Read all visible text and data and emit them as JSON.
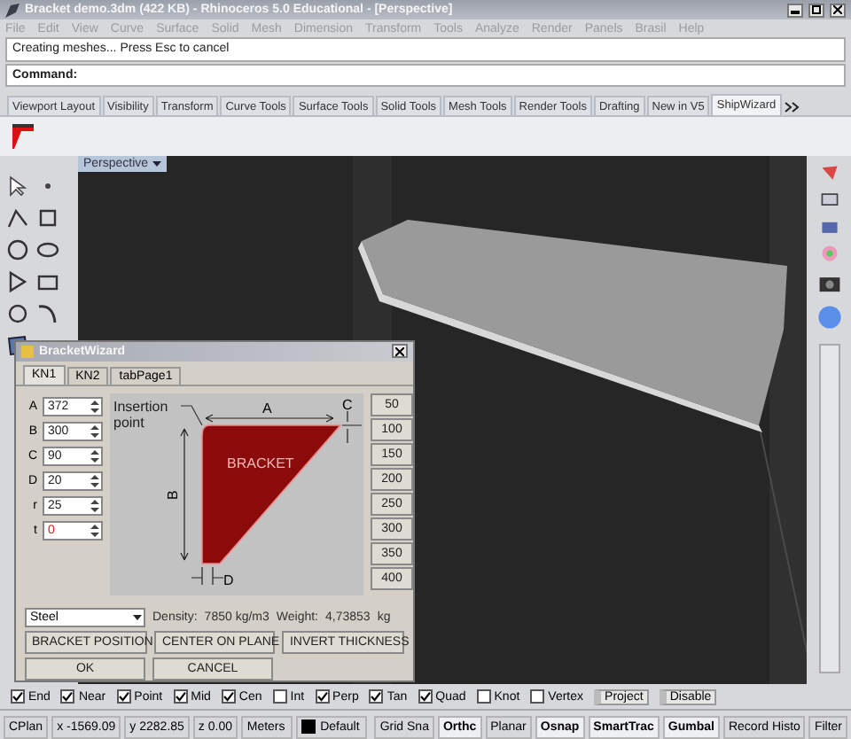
{
  "window": {
    "title": "Bracket demo.3dm (422 KB) - Rhinoceros 5.0 Educational - [Perspective]"
  },
  "menu": [
    "File",
    "Edit",
    "View",
    "Curve",
    "Surface",
    "Solid",
    "Mesh",
    "Dimension",
    "Transform",
    "Tools",
    "Analyze",
    "Render",
    "Panels",
    "Brasil",
    "Help"
  ],
  "command": {
    "history": "Creating meshes... Press Esc to cancel",
    "prompt": "Command:"
  },
  "toolbar_tabs": [
    {
      "label": "Viewport Layout",
      "selected": false
    },
    {
      "label": "Visibility",
      "selected": false
    },
    {
      "label": "Transform",
      "selected": false
    },
    {
      "label": "Curve Tools",
      "selected": false
    },
    {
      "label": "Surface Tools",
      "selected": false
    },
    {
      "label": "Solid Tools",
      "selected": false
    },
    {
      "label": "Mesh Tools",
      "selected": false
    },
    {
      "label": "Render Tools",
      "selected": false
    },
    {
      "label": "Drafting",
      "selected": false
    },
    {
      "label": "New in V5",
      "selected": false
    },
    {
      "label": "ShipWizard",
      "selected": true
    }
  ],
  "viewport": {
    "title": "Perspective"
  },
  "dialog": {
    "title": "BracketWizard",
    "tabs": [
      {
        "label": "KN1",
        "selected": true
      },
      {
        "label": "KN2",
        "selected": false
      },
      {
        "label": "tabPage1",
        "selected": false
      }
    ],
    "fields": [
      {
        "label": "A",
        "value": "372",
        "error": false
      },
      {
        "label": "B",
        "value": "300",
        "error": false
      },
      {
        "label": "C",
        "value": "90",
        "error": false
      },
      {
        "label": "D",
        "value": "20",
        "error": false
      },
      {
        "label": "r",
        "value": "25",
        "error": false
      },
      {
        "label": "t",
        "value": "0",
        "error": true
      }
    ],
    "diagram": {
      "insertion_label": "Insertion point",
      "a": "A",
      "b": "B",
      "c": "C",
      "d": "D",
      "shape_label": "BRACKET"
    },
    "presets": [
      "50",
      "100",
      "150",
      "200",
      "250",
      "300",
      "350",
      "400"
    ],
    "material": "Steel",
    "density_label": "Density:",
    "density": "7850 kg/m3",
    "weight_label": "Weight:",
    "weight": "4,73853",
    "weight_unit": "kg",
    "actions": [
      "BRACKET POSITION",
      "CENTER ON PLANE",
      "INVERT THICKNESS"
    ],
    "buttons": [
      "OK",
      "CANCEL"
    ]
  },
  "osnaps": [
    {
      "label": "End",
      "checked": true,
      "kind": "checkbox"
    },
    {
      "label": "Near",
      "checked": true,
      "kind": "checkbox"
    },
    {
      "label": "Point",
      "checked": true,
      "kind": "checkbox"
    },
    {
      "label": "Mid",
      "checked": true,
      "kind": "checkbox"
    },
    {
      "label": "Cen",
      "checked": true,
      "kind": "checkbox"
    },
    {
      "label": "Int",
      "checked": false,
      "kind": "checkbox"
    },
    {
      "label": "Perp",
      "checked": true,
      "kind": "checkbox"
    },
    {
      "label": "Tan",
      "checked": true,
      "kind": "checkbox"
    },
    {
      "label": "Quad",
      "checked": true,
      "kind": "checkbox"
    },
    {
      "label": "Knot",
      "checked": false,
      "kind": "checkbox"
    },
    {
      "label": "Vertex",
      "checked": false,
      "kind": "checkbox"
    },
    {
      "label": "Project",
      "checked": false,
      "kind": "toggle"
    },
    {
      "label": "Disable",
      "checked": false,
      "kind": "toggle"
    }
  ],
  "status_bar": {
    "cplane": "CPlan",
    "x": "x -1569.09",
    "y": "y 2282.85",
    "z": "z 0.00",
    "units": "Meters",
    "layer": "Default",
    "panes": [
      {
        "label": "Grid Sna",
        "on": false
      },
      {
        "label": "Orthc",
        "on": true
      },
      {
        "label": "Planar",
        "on": false
      },
      {
        "label": "Osnap",
        "on": true
      },
      {
        "label": "SmartTrac",
        "on": true
      },
      {
        "label": "Gumbal",
        "on": true
      },
      {
        "label": "Record Histo",
        "on": false
      },
      {
        "label": "Filter",
        "on": false
      }
    ]
  }
}
